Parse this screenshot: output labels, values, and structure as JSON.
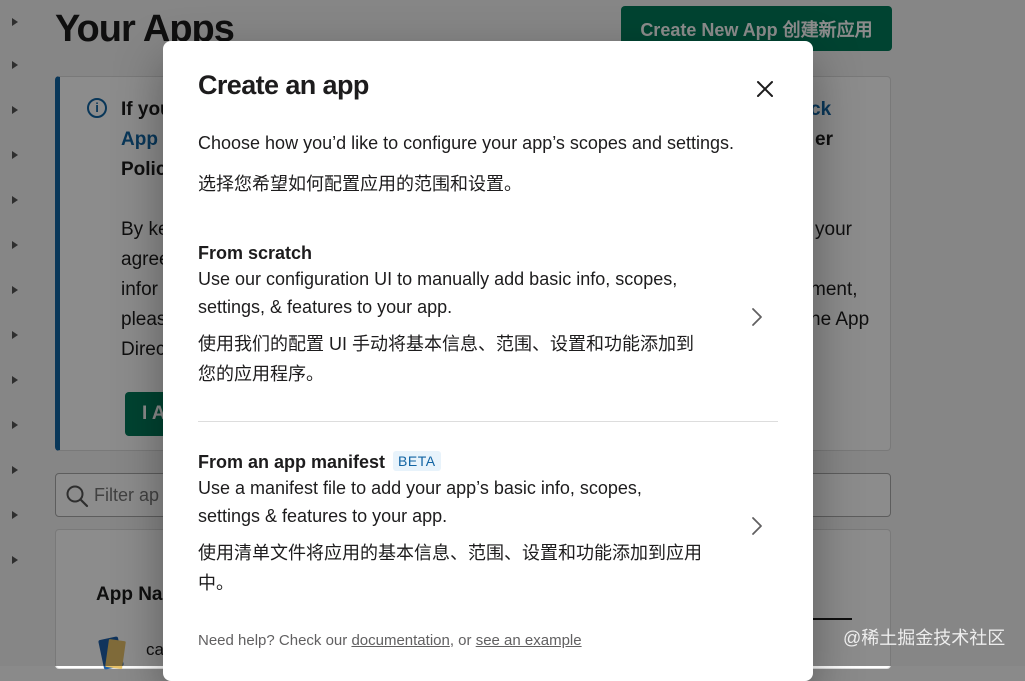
{
  "background": {
    "title": "Your Apps",
    "create_button": "Create New App 创建新应用",
    "banner": {
      "line1_left": "If you",
      "line1_right": "ck",
      "line2_left": "App",
      "line2_right": "er",
      "line3_left": "Polic",
      "line4_left": "By ke",
      "line4_right": "your",
      "line5_left": "agree",
      "line6_left": "infor",
      "line6_right": "ment,",
      "line7_left": "pleas",
      "line7_right": "ne App",
      "line8_left": "Direc",
      "agree_button": "I A"
    },
    "filter_placeholder": "Filter ap",
    "table": {
      "column_header": "App Na",
      "row_app_name": "ca"
    }
  },
  "modal": {
    "title": "Create an app",
    "description_en": "Choose how you’d like to configure your app’s scopes and settings.",
    "description_zh": "选择您希望如何配置应用的范围和设置。",
    "options": [
      {
        "title": "From scratch",
        "text": "Use our configuration UI to manually add basic info, scopes, settings, & features to your app.",
        "text_zh": "使用我们的配置 UI 手动将基本信息、范围、设置和功能添加到您的应用程序。"
      },
      {
        "title": "From an app manifest",
        "badge": "BETA",
        "text": "Use a manifest file to add your app’s basic info, scopes, settings & features to your app.",
        "text_zh": "使用清单文件将应用的基本信息、范围、设置和功能添加到应用中。"
      }
    ],
    "help": {
      "prefix": "Need help? Check our ",
      "documentation_link": "documentation",
      "middle": ", or ",
      "example_link": "see an example"
    }
  },
  "watermark": "@稀土掘金技术社区",
  "icons": {
    "close": "close-icon",
    "chevron": "chevron-right-icon",
    "info": "info-icon",
    "search": "search-icon"
  },
  "colors": {
    "primary_green": "#007a5a",
    "link_blue": "#1264a3",
    "text": "#1d1c1d",
    "muted": "#616061"
  }
}
